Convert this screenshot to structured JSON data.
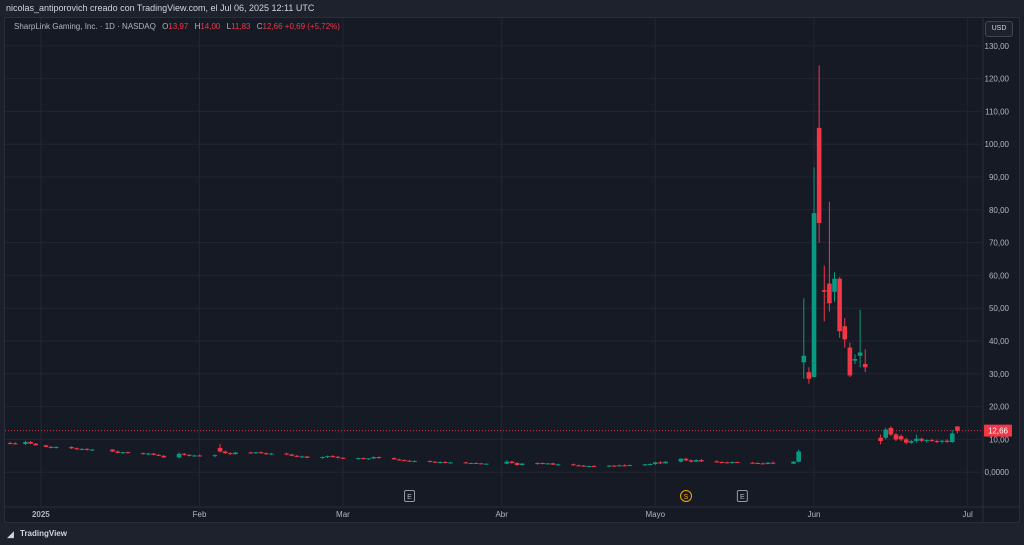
{
  "header": {
    "attribution": "nicolas_antiporovich creado con TradingView.com, el Jul 06, 2025 12:11 UTC"
  },
  "legend": {
    "symbol": "SharpLink Gaming, Inc. · 1D · NASDAQ",
    "o_label": "O",
    "o_value": "13,97",
    "h_label": "H",
    "h_value": "14,00",
    "l_label": "L",
    "l_value": "11,83",
    "c_label": "C",
    "c_value": "12,66",
    "change": "+0,69 (+5,72%)"
  },
  "currency": "USD",
  "footer": {
    "brand": "TradingView"
  },
  "colors": {
    "up": "#089981",
    "down": "#f23645",
    "grid": "#232632",
    "axis_text": "#b2b5be",
    "background": "#161a25"
  },
  "chart_data": {
    "type": "candlestick",
    "title": "SharpLink Gaming, Inc. · 1D · NASDAQ",
    "y_axis": {
      "ticks": [
        0,
        10,
        20,
        30,
        40,
        50,
        60,
        70,
        80,
        90,
        100,
        110,
        120,
        130
      ],
      "tick_labels": [
        "0,0000",
        "10,00",
        "20,00",
        "30,00",
        "40,00",
        "50,00",
        "60,00",
        "70,00",
        "80,00",
        "90,00",
        "100,00",
        "110,00",
        "120,00",
        "130,00"
      ],
      "range": [
        -10,
        133
      ]
    },
    "x_axis": {
      "labels": [
        {
          "text": "2025",
          "day": 0
        },
        {
          "text": "Feb",
          "day": 31
        },
        {
          "text": "Mar",
          "day": 59
        },
        {
          "text": "Abr",
          "day": 90
        },
        {
          "text": "Mayo",
          "day": 120
        },
        {
          "text": "Jun",
          "day": 151
        },
        {
          "text": "Jul",
          "day": 181
        }
      ],
      "range_days": [
        -7,
        184
      ]
    },
    "last_price": {
      "value": 12.66,
      "label": "12,66"
    },
    "events": [
      {
        "type": "E",
        "day": 72
      },
      {
        "type": "S",
        "day": 126
      },
      {
        "type": "E",
        "day": 137
      }
    ],
    "candles": [
      {
        "d": -6,
        "o": 8.9,
        "h": 9.3,
        "l": 8.5,
        "c": 8.8
      },
      {
        "d": -5,
        "o": 8.8,
        "h": 9.1,
        "l": 8.4,
        "c": 8.6
      },
      {
        "d": -3,
        "o": 8.6,
        "h": 9.6,
        "l": 8.3,
        "c": 9.2
      },
      {
        "d": -2,
        "o": 9.2,
        "h": 9.5,
        "l": 8.6,
        "c": 8.7
      },
      {
        "d": -1,
        "o": 8.7,
        "h": 8.9,
        "l": 8.1,
        "c": 8.2
      },
      {
        "d": 1,
        "o": 8.2,
        "h": 8.4,
        "l": 7.6,
        "c": 7.7
      },
      {
        "d": 2,
        "o": 7.7,
        "h": 8.0,
        "l": 7.3,
        "c": 7.5
      },
      {
        "d": 3,
        "o": 7.5,
        "h": 7.9,
        "l": 7.2,
        "c": 7.7
      },
      {
        "d": 6,
        "o": 7.7,
        "h": 7.9,
        "l": 7.1,
        "c": 7.3
      },
      {
        "d": 7,
        "o": 7.3,
        "h": 7.5,
        "l": 6.8,
        "c": 7.0
      },
      {
        "d": 8,
        "o": 7.0,
        "h": 7.3,
        "l": 6.7,
        "c": 7.1
      },
      {
        "d": 9,
        "o": 7.1,
        "h": 7.3,
        "l": 6.6,
        "c": 6.8
      },
      {
        "d": 10,
        "o": 6.8,
        "h": 7.1,
        "l": 6.5,
        "c": 6.9
      },
      {
        "d": 14,
        "o": 6.9,
        "h": 7.0,
        "l": 6.2,
        "c": 6.3
      },
      {
        "d": 15,
        "o": 6.3,
        "h": 6.6,
        "l": 5.8,
        "c": 5.9
      },
      {
        "d": 16,
        "o": 5.9,
        "h": 6.2,
        "l": 5.6,
        "c": 6.1
      },
      {
        "d": 17,
        "o": 6.1,
        "h": 6.3,
        "l": 5.7,
        "c": 5.8
      },
      {
        "d": 20,
        "o": 5.8,
        "h": 6.0,
        "l": 5.4,
        "c": 5.6
      },
      {
        "d": 21,
        "o": 5.6,
        "h": 5.9,
        "l": 5.3,
        "c": 5.7
      },
      {
        "d": 22,
        "o": 5.7,
        "h": 5.8,
        "l": 5.2,
        "c": 5.3
      },
      {
        "d": 23,
        "o": 5.3,
        "h": 5.5,
        "l": 4.9,
        "c": 5.0
      },
      {
        "d": 24,
        "o": 5.0,
        "h": 5.2,
        "l": 4.4,
        "c": 4.5
      },
      {
        "d": 27,
        "o": 4.5,
        "h": 6.0,
        "l": 4.2,
        "c": 5.6
      },
      {
        "d": 28,
        "o": 5.6,
        "h": 5.9,
        "l": 5.1,
        "c": 5.3
      },
      {
        "d": 29,
        "o": 5.3,
        "h": 5.5,
        "l": 4.8,
        "c": 5.0
      },
      {
        "d": 30,
        "o": 5.0,
        "h": 5.3,
        "l": 4.7,
        "c": 5.1
      },
      {
        "d": 31,
        "o": 5.1,
        "h": 5.4,
        "l": 4.8,
        "c": 4.9
      },
      {
        "d": 34,
        "o": 4.9,
        "h": 5.4,
        "l": 4.6,
        "c": 5.2
      },
      {
        "d": 35,
        "o": 7.4,
        "h": 8.6,
        "l": 6.0,
        "c": 6.3
      },
      {
        "d": 36,
        "o": 6.3,
        "h": 6.6,
        "l": 5.6,
        "c": 5.8
      },
      {
        "d": 37,
        "o": 5.8,
        "h": 6.1,
        "l": 5.3,
        "c": 5.5
      },
      {
        "d": 38,
        "o": 5.5,
        "h": 6.2,
        "l": 5.4,
        "c": 6.0
      },
      {
        "d": 41,
        "o": 6.0,
        "h": 6.3,
        "l": 5.7,
        "c": 5.9
      },
      {
        "d": 42,
        "o": 5.9,
        "h": 6.2,
        "l": 5.5,
        "c": 6.1
      },
      {
        "d": 43,
        "o": 6.1,
        "h": 6.3,
        "l": 5.6,
        "c": 5.8
      },
      {
        "d": 44,
        "o": 5.8,
        "h": 6.0,
        "l": 5.3,
        "c": 5.5
      },
      {
        "d": 45,
        "o": 5.5,
        "h": 5.9,
        "l": 5.2,
        "c": 5.7
      },
      {
        "d": 48,
        "o": 5.7,
        "h": 5.9,
        "l": 5.2,
        "c": 5.4
      },
      {
        "d": 49,
        "o": 5.4,
        "h": 5.6,
        "l": 4.9,
        "c": 5.0
      },
      {
        "d": 50,
        "o": 5.0,
        "h": 5.2,
        "l": 4.6,
        "c": 4.7
      },
      {
        "d": 51,
        "o": 4.7,
        "h": 5.0,
        "l": 4.4,
        "c": 4.8
      },
      {
        "d": 52,
        "o": 4.8,
        "h": 4.9,
        "l": 4.3,
        "c": 4.4
      },
      {
        "d": 55,
        "o": 4.4,
        "h": 4.8,
        "l": 4.1,
        "c": 4.6
      },
      {
        "d": 56,
        "o": 4.6,
        "h": 5.1,
        "l": 4.3,
        "c": 4.9
      },
      {
        "d": 57,
        "o": 4.9,
        "h": 5.2,
        "l": 4.5,
        "c": 4.7
      },
      {
        "d": 58,
        "o": 4.7,
        "h": 4.9,
        "l": 4.2,
        "c": 4.4
      },
      {
        "d": 59,
        "o": 4.4,
        "h": 4.6,
        "l": 4.0,
        "c": 4.2
      },
      {
        "d": 62,
        "o": 4.2,
        "h": 4.5,
        "l": 3.9,
        "c": 4.3
      },
      {
        "d": 63,
        "o": 4.3,
        "h": 4.5,
        "l": 4.0,
        "c": 4.1
      },
      {
        "d": 64,
        "o": 4.1,
        "h": 4.3,
        "l": 3.8,
        "c": 4.2
      },
      {
        "d": 65,
        "o": 4.2,
        "h": 4.8,
        "l": 4.0,
        "c": 4.6
      },
      {
        "d": 66,
        "o": 4.6,
        "h": 4.8,
        "l": 4.1,
        "c": 4.3
      },
      {
        "d": 69,
        "o": 4.3,
        "h": 4.5,
        "l": 3.8,
        "c": 3.9
      },
      {
        "d": 70,
        "o": 3.9,
        "h": 4.1,
        "l": 3.5,
        "c": 3.7
      },
      {
        "d": 71,
        "o": 3.7,
        "h": 3.9,
        "l": 3.3,
        "c": 3.5
      },
      {
        "d": 72,
        "o": 3.5,
        "h": 3.7,
        "l": 3.2,
        "c": 3.3
      },
      {
        "d": 73,
        "o": 3.3,
        "h": 3.6,
        "l": 3.1,
        "c": 3.4
      },
      {
        "d": 76,
        "o": 3.4,
        "h": 3.6,
        "l": 3.0,
        "c": 3.2
      },
      {
        "d": 77,
        "o": 3.2,
        "h": 3.4,
        "l": 2.9,
        "c": 3.0
      },
      {
        "d": 78,
        "o": 3.0,
        "h": 3.3,
        "l": 2.8,
        "c": 3.1
      },
      {
        "d": 79,
        "o": 3.1,
        "h": 3.3,
        "l": 2.7,
        "c": 2.8
      },
      {
        "d": 80,
        "o": 2.8,
        "h": 3.1,
        "l": 2.6,
        "c": 3.0
      },
      {
        "d": 83,
        "o": 3.0,
        "h": 3.2,
        "l": 2.6,
        "c": 2.7
      },
      {
        "d": 84,
        "o": 2.7,
        "h": 2.9,
        "l": 2.5,
        "c": 2.8
      },
      {
        "d": 85,
        "o": 2.8,
        "h": 3.0,
        "l": 2.6,
        "c": 2.7
      },
      {
        "d": 86,
        "o": 2.7,
        "h": 2.8,
        "l": 2.4,
        "c": 2.5
      },
      {
        "d": 87,
        "o": 2.5,
        "h": 2.7,
        "l": 2.3,
        "c": 2.6
      },
      {
        "d": 91,
        "o": 2.6,
        "h": 3.6,
        "l": 2.4,
        "c": 3.2
      },
      {
        "d": 92,
        "o": 3.2,
        "h": 3.5,
        "l": 2.6,
        "c": 2.8
      },
      {
        "d": 93,
        "o": 2.8,
        "h": 3.0,
        "l": 2.0,
        "c": 2.2
      },
      {
        "d": 94,
        "o": 2.2,
        "h": 2.8,
        "l": 2.0,
        "c": 2.6
      },
      {
        "d": 97,
        "o": 2.6,
        "h": 3.0,
        "l": 2.3,
        "c": 2.8
      },
      {
        "d": 98,
        "o": 2.8,
        "h": 2.9,
        "l": 2.4,
        "c": 2.5
      },
      {
        "d": 99,
        "o": 2.5,
        "h": 2.8,
        "l": 2.3,
        "c": 2.7
      },
      {
        "d": 100,
        "o": 2.7,
        "h": 2.9,
        "l": 2.2,
        "c": 2.3
      },
      {
        "d": 101,
        "o": 2.3,
        "h": 2.6,
        "l": 2.0,
        "c": 2.4
      },
      {
        "d": 104,
        "o": 2.4,
        "h": 2.6,
        "l": 2.0,
        "c": 2.1
      },
      {
        "d": 105,
        "o": 2.1,
        "h": 2.3,
        "l": 1.8,
        "c": 2.0
      },
      {
        "d": 106,
        "o": 2.0,
        "h": 2.2,
        "l": 1.7,
        "c": 1.8
      },
      {
        "d": 107,
        "o": 1.8,
        "h": 2.0,
        "l": 1.6,
        "c": 1.9
      },
      {
        "d": 108,
        "o": 1.9,
        "h": 2.1,
        "l": 1.6,
        "c": 1.7
      },
      {
        "d": 111,
        "o": 1.7,
        "h": 2.2,
        "l": 1.6,
        "c": 2.0
      },
      {
        "d": 112,
        "o": 2.0,
        "h": 2.2,
        "l": 1.7,
        "c": 1.8
      },
      {
        "d": 113,
        "o": 1.8,
        "h": 2.3,
        "l": 1.7,
        "c": 2.1
      },
      {
        "d": 114,
        "o": 2.1,
        "h": 2.4,
        "l": 1.8,
        "c": 1.9
      },
      {
        "d": 115,
        "o": 1.9,
        "h": 2.3,
        "l": 1.8,
        "c": 2.2
      },
      {
        "d": 118,
        "o": 2.2,
        "h": 2.5,
        "l": 1.9,
        "c": 2.4
      },
      {
        "d": 119,
        "o": 2.4,
        "h": 2.7,
        "l": 2.1,
        "c": 2.5
      },
      {
        "d": 120,
        "o": 2.5,
        "h": 3.2,
        "l": 2.2,
        "c": 3.0
      },
      {
        "d": 121,
        "o": 3.0,
        "h": 3.3,
        "l": 2.5,
        "c": 2.7
      },
      {
        "d": 122,
        "o": 2.7,
        "h": 3.4,
        "l": 2.6,
        "c": 3.2
      },
      {
        "d": 125,
        "o": 3.2,
        "h": 4.3,
        "l": 3.0,
        "c": 4.1
      },
      {
        "d": 126,
        "o": 4.1,
        "h": 4.4,
        "l": 3.4,
        "c": 3.6
      },
      {
        "d": 127,
        "o": 3.6,
        "h": 3.9,
        "l": 3.0,
        "c": 3.2
      },
      {
        "d": 128,
        "o": 3.2,
        "h": 3.9,
        "l": 3.1,
        "c": 3.7
      },
      {
        "d": 129,
        "o": 3.7,
        "h": 4.0,
        "l": 3.1,
        "c": 3.3
      },
      {
        "d": 132,
        "o": 3.3,
        "h": 3.6,
        "l": 2.9,
        "c": 3.1
      },
      {
        "d": 133,
        "o": 3.1,
        "h": 3.3,
        "l": 2.8,
        "c": 3.0
      },
      {
        "d": 134,
        "o": 3.0,
        "h": 3.2,
        "l": 2.7,
        "c": 2.9
      },
      {
        "d": 135,
        "o": 2.9,
        "h": 3.3,
        "l": 2.7,
        "c": 3.1
      },
      {
        "d": 136,
        "o": 3.1,
        "h": 3.2,
        "l": 2.8,
        "c": 2.9
      },
      {
        "d": 139,
        "o": 2.9,
        "h": 3.1,
        "l": 2.6,
        "c": 2.8
      },
      {
        "d": 140,
        "o": 2.8,
        "h": 3.0,
        "l": 2.5,
        "c": 2.7
      },
      {
        "d": 141,
        "o": 2.7,
        "h": 2.9,
        "l": 2.4,
        "c": 2.5
      },
      {
        "d": 142,
        "o": 2.5,
        "h": 3.1,
        "l": 2.4,
        "c": 2.9
      },
      {
        "d": 143,
        "o": 2.9,
        "h": 3.2,
        "l": 2.5,
        "c": 2.6
      },
      {
        "d": 147,
        "o": 2.6,
        "h": 3.4,
        "l": 2.5,
        "c": 3.2
      },
      {
        "d": 148,
        "o": 3.2,
        "h": 6.9,
        "l": 3.0,
        "c": 6.3
      },
      {
        "d": 149,
        "o": 33.5,
        "h": 53.0,
        "l": 28.5,
        "c": 35.5
      },
      {
        "d": 150,
        "o": 30.5,
        "h": 32.0,
        "l": 27.0,
        "c": 28.5
      },
      {
        "d": 151,
        "o": 29.0,
        "h": 93.0,
        "l": 29.0,
        "c": 79.0
      },
      {
        "d": 152,
        "o": 105.0,
        "h": 124.0,
        "l": 70.0,
        "c": 76.0
      },
      {
        "d": 153,
        "o": 55.5,
        "h": 63.0,
        "l": 46.0,
        "c": 55.0
      },
      {
        "d": 154,
        "o": 57.5,
        "h": 82.5,
        "l": 49.0,
        "c": 51.5
      },
      {
        "d": 155,
        "o": 55.0,
        "h": 61.0,
        "l": 52.0,
        "c": 59.0
      },
      {
        "d": 156,
        "o": 59.0,
        "h": 59.5,
        "l": 41.0,
        "c": 43.0
      },
      {
        "d": 157,
        "o": 44.5,
        "h": 47.0,
        "l": 38.0,
        "c": 40.5
      },
      {
        "d": 158,
        "o": 38.0,
        "h": 39.5,
        "l": 29.0,
        "c": 29.5
      },
      {
        "d": 159,
        "o": 34.0,
        "h": 36.0,
        "l": 33.0,
        "c": 34.5
      },
      {
        "d": 160,
        "o": 35.5,
        "h": 49.5,
        "l": 32.0,
        "c": 36.5
      },
      {
        "d": 161,
        "o": 33.0,
        "h": 37.5,
        "l": 30.5,
        "c": 32.0
      },
      {
        "d": 164,
        "o": 10.5,
        "h": 11.5,
        "l": 8.5,
        "c": 9.5
      },
      {
        "d": 165,
        "o": 10.5,
        "h": 13.5,
        "l": 10.0,
        "c": 13.0
      },
      {
        "d": 166,
        "o": 13.5,
        "h": 14.0,
        "l": 11.0,
        "c": 11.5
      },
      {
        "d": 167,
        "o": 11.5,
        "h": 12.0,
        "l": 9.5,
        "c": 10.0
      },
      {
        "d": 168,
        "o": 11.0,
        "h": 11.5,
        "l": 9.5,
        "c": 10.0
      },
      {
        "d": 169,
        "o": 10.0,
        "h": 10.5,
        "l": 8.5,
        "c": 9.0
      },
      {
        "d": 170,
        "o": 9.0,
        "h": 9.8,
        "l": 8.6,
        "c": 9.5
      },
      {
        "d": 171,
        "o": 9.5,
        "h": 11.5,
        "l": 9.0,
        "c": 10.2
      },
      {
        "d": 172,
        "o": 10.2,
        "h": 10.5,
        "l": 9.2,
        "c": 9.6
      },
      {
        "d": 173,
        "o": 9.6,
        "h": 10.0,
        "l": 9.0,
        "c": 9.8
      },
      {
        "d": 174,
        "o": 9.8,
        "h": 10.2,
        "l": 9.3,
        "c": 9.5
      },
      {
        "d": 175,
        "o": 9.5,
        "h": 9.9,
        "l": 8.9,
        "c": 9.3
      },
      {
        "d": 176,
        "o": 9.3,
        "h": 9.8,
        "l": 8.8,
        "c": 9.6
      },
      {
        "d": 177,
        "o": 9.6,
        "h": 10.0,
        "l": 9.0,
        "c": 9.2
      },
      {
        "d": 178,
        "o": 9.2,
        "h": 12.8,
        "l": 9.0,
        "c": 11.8
      },
      {
        "d": 179,
        "o": 13.97,
        "h": 14.0,
        "l": 11.83,
        "c": 12.66
      }
    ]
  }
}
